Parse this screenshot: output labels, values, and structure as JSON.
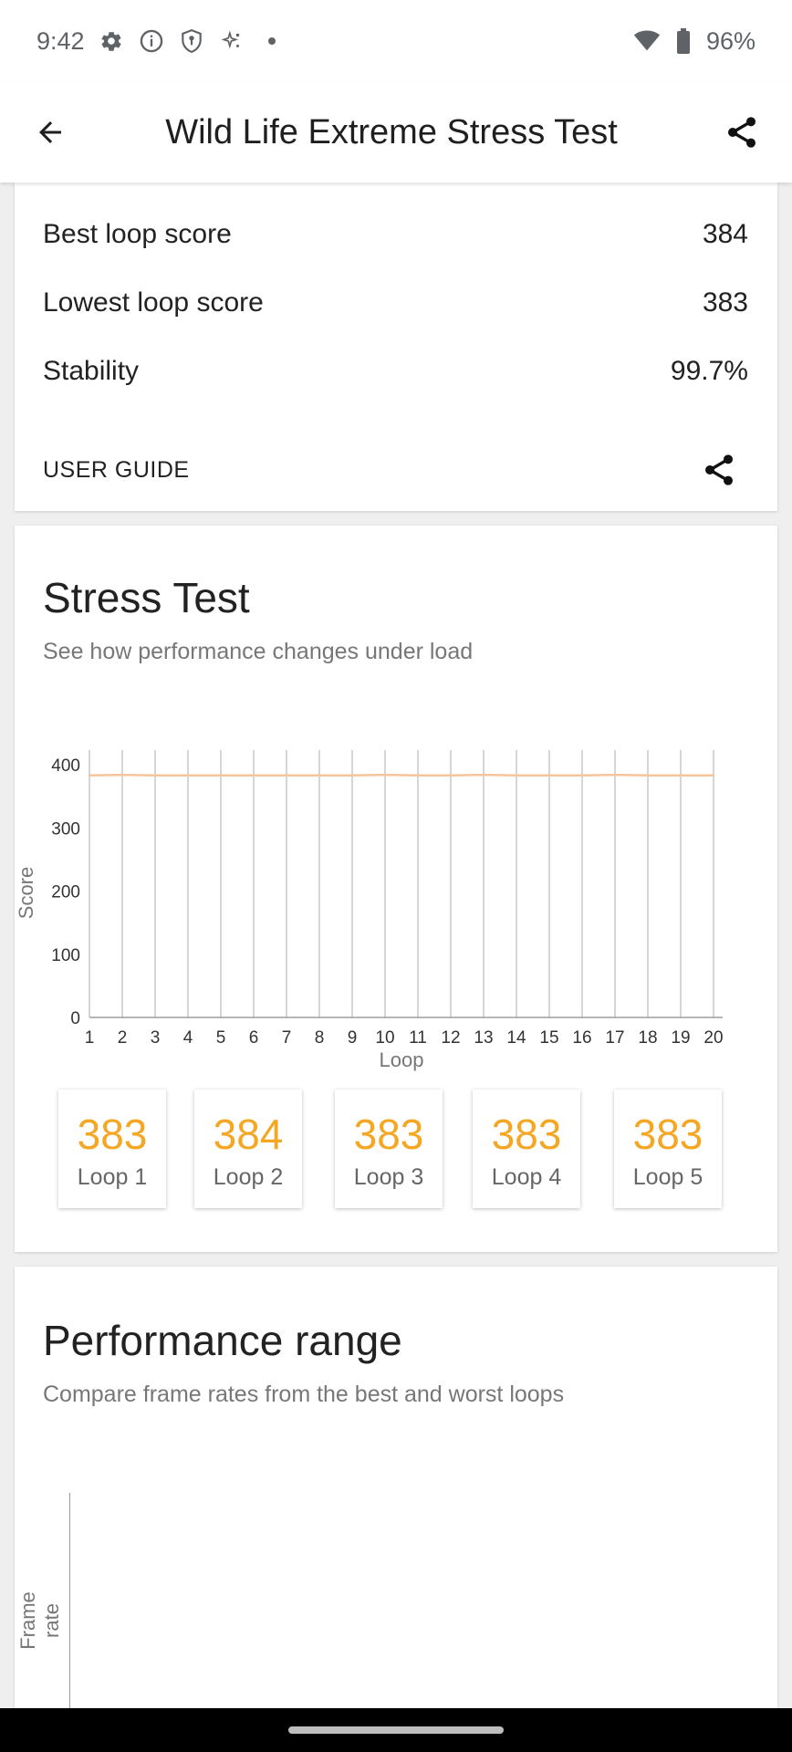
{
  "status_bar": {
    "time": "9:42",
    "battery": "96%",
    "icons": [
      "settings-icon",
      "info-icon",
      "shield-icon",
      "sparkle-icon",
      "dot-icon",
      "wifi-icon",
      "battery-icon"
    ]
  },
  "app_bar": {
    "title": "Wild Life Extreme Stress Test",
    "icons": [
      "back-arrow-icon",
      "share-icon"
    ]
  },
  "summary": {
    "rows": [
      {
        "label": "Best loop score",
        "value": "384"
      },
      {
        "label": "Lowest loop score",
        "value": "383"
      },
      {
        "label": "Stability",
        "value": "99.7%"
      }
    ],
    "user_guide": "USER GUIDE"
  },
  "stress_test": {
    "title": "Stress Test",
    "subtitle": "See how performance changes under load",
    "loops": [
      {
        "score": "383",
        "label": "Loop 1"
      },
      {
        "score": "384",
        "label": "Loop 2"
      },
      {
        "score": "383",
        "label": "Loop 3"
      },
      {
        "score": "383",
        "label": "Loop 4"
      },
      {
        "score": "383",
        "label": "Loop 5"
      }
    ]
  },
  "chart_data": {
    "type": "line",
    "title": "",
    "xlabel": "Loop",
    "ylabel": "Score",
    "x": [
      1,
      2,
      3,
      4,
      5,
      6,
      7,
      8,
      9,
      10,
      11,
      12,
      13,
      14,
      15,
      16,
      17,
      18,
      19,
      20
    ],
    "series": [
      {
        "values": [
          383,
          384,
          383,
          383,
          383,
          383,
          383,
          383,
          383,
          384,
          383,
          383,
          384,
          383,
          383,
          383,
          384,
          383,
          383,
          383
        ]
      }
    ],
    "yticks": [
      0,
      100,
      200,
      300,
      400
    ],
    "ylim": [
      0,
      400
    ],
    "xlim": [
      1,
      20
    ],
    "grid": "vertical",
    "line_color": "#f5c49a"
  },
  "performance_range": {
    "title": "Performance range",
    "subtitle": "Compare frame rates from the best and worst loops",
    "ylabel": "Frame rate"
  }
}
